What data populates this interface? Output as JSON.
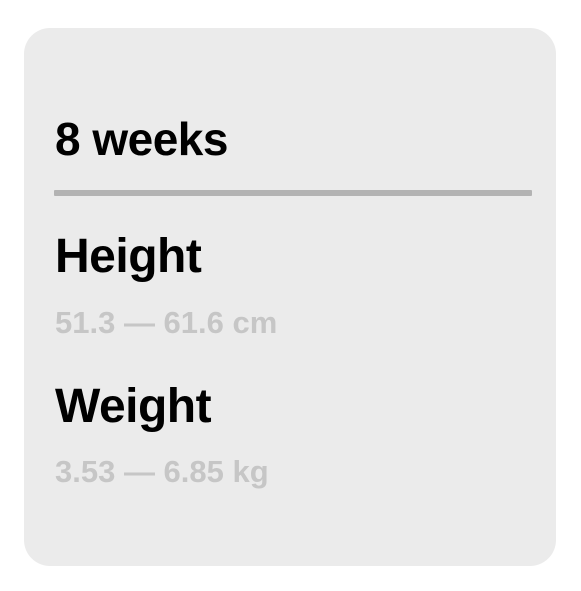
{
  "card": {
    "title": "8 weeks",
    "metrics": [
      {
        "label": "Height",
        "range": "51.3 — 61.6 cm"
      },
      {
        "label": "Weight",
        "range": "3.53 — 6.85 kg"
      }
    ]
  },
  "colors": {
    "card_background": "#ebebeb",
    "divider": "#b3b3b3",
    "primary_text": "#000000",
    "secondary_text": "#c6c6c6"
  }
}
